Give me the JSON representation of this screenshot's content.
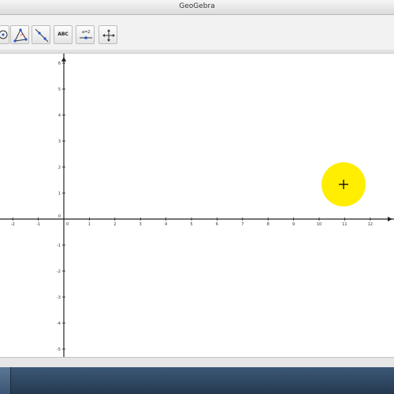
{
  "window": {
    "title": "GeoGebra"
  },
  "toolbar": {
    "tools": [
      {
        "name": "point-tool-icon"
      },
      {
        "name": "polygon-tool-icon"
      },
      {
        "name": "line-tool-icon"
      },
      {
        "name": "text-tool-icon",
        "label": "ABC"
      },
      {
        "name": "slider-tool-icon",
        "label": "a=2"
      },
      {
        "name": "move-graphics-view-icon"
      }
    ]
  },
  "graphics_view": {
    "x_ticks": [
      "-2",
      "-1",
      "0",
      "1",
      "2",
      "3",
      "4",
      "5",
      "6",
      "7",
      "8",
      "9",
      "10",
      "11",
      "12"
    ],
    "y_ticks_positive": [
      "6",
      "5",
      "4",
      "3",
      "2",
      "1",
      "0"
    ],
    "y_ticks_negative": [
      "-1",
      "-2",
      "-3",
      "-4",
      "-5"
    ],
    "cursor_highlight_color": "#ffee00"
  }
}
